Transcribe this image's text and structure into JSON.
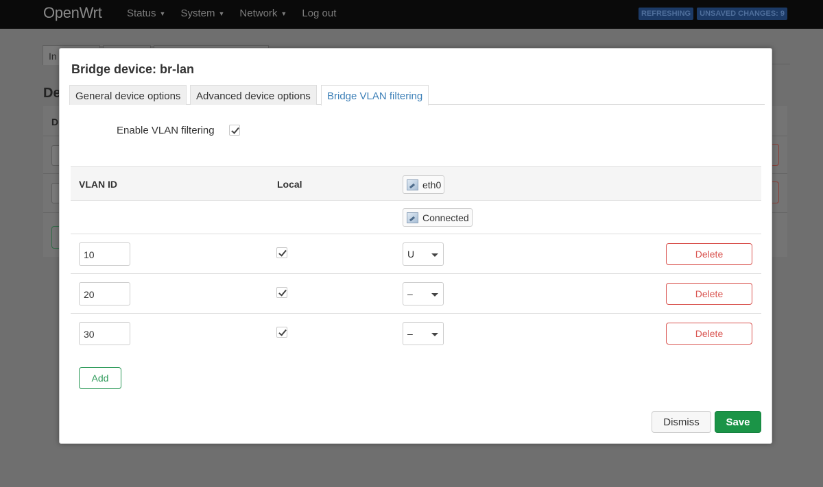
{
  "navbar": {
    "brand": "OpenWrt",
    "menu": [
      {
        "label": "Status",
        "dropdown": true
      },
      {
        "label": "System",
        "dropdown": true
      },
      {
        "label": "Network",
        "dropdown": true
      },
      {
        "label": "Log out",
        "dropdown": false
      }
    ],
    "badges": [
      "REFRESHING",
      "UNSAVED CHANGES: 9"
    ]
  },
  "background_page": {
    "tab_fragment": "In",
    "heading_fragment": "De",
    "table_header_fragment": "D"
  },
  "modal": {
    "title": "Bridge device: br-lan",
    "tabs": [
      {
        "label": "General device options",
        "active": false
      },
      {
        "label": "Advanced device options",
        "active": false
      },
      {
        "label": "Bridge VLAN filtering",
        "active": true
      }
    ],
    "enable_vlan_filtering": {
      "label": "Enable VLAN filtering",
      "checked": true
    },
    "table": {
      "headers": {
        "vlan_id": "VLAN ID",
        "local": "Local"
      },
      "port": {
        "name": "eth0",
        "status": "Connected",
        "icon": "ethernet-port-icon"
      },
      "rows": [
        {
          "vlan_id": "10",
          "local": true,
          "port_value": "U",
          "delete_label": "Delete"
        },
        {
          "vlan_id": "20",
          "local": true,
          "port_value": "–",
          "delete_label": "Delete"
        },
        {
          "vlan_id": "30",
          "local": true,
          "port_value": "–",
          "delete_label": "Delete"
        }
      ]
    },
    "add_label": "Add",
    "dismiss_label": "Dismiss",
    "save_label": "Save"
  },
  "colors": {
    "navbar_bg": "#0a0a0a",
    "active_tab": "#3c7fb7",
    "delete": "#d9534f",
    "add": "#2e9a5a",
    "save_bg": "#1b9447"
  }
}
